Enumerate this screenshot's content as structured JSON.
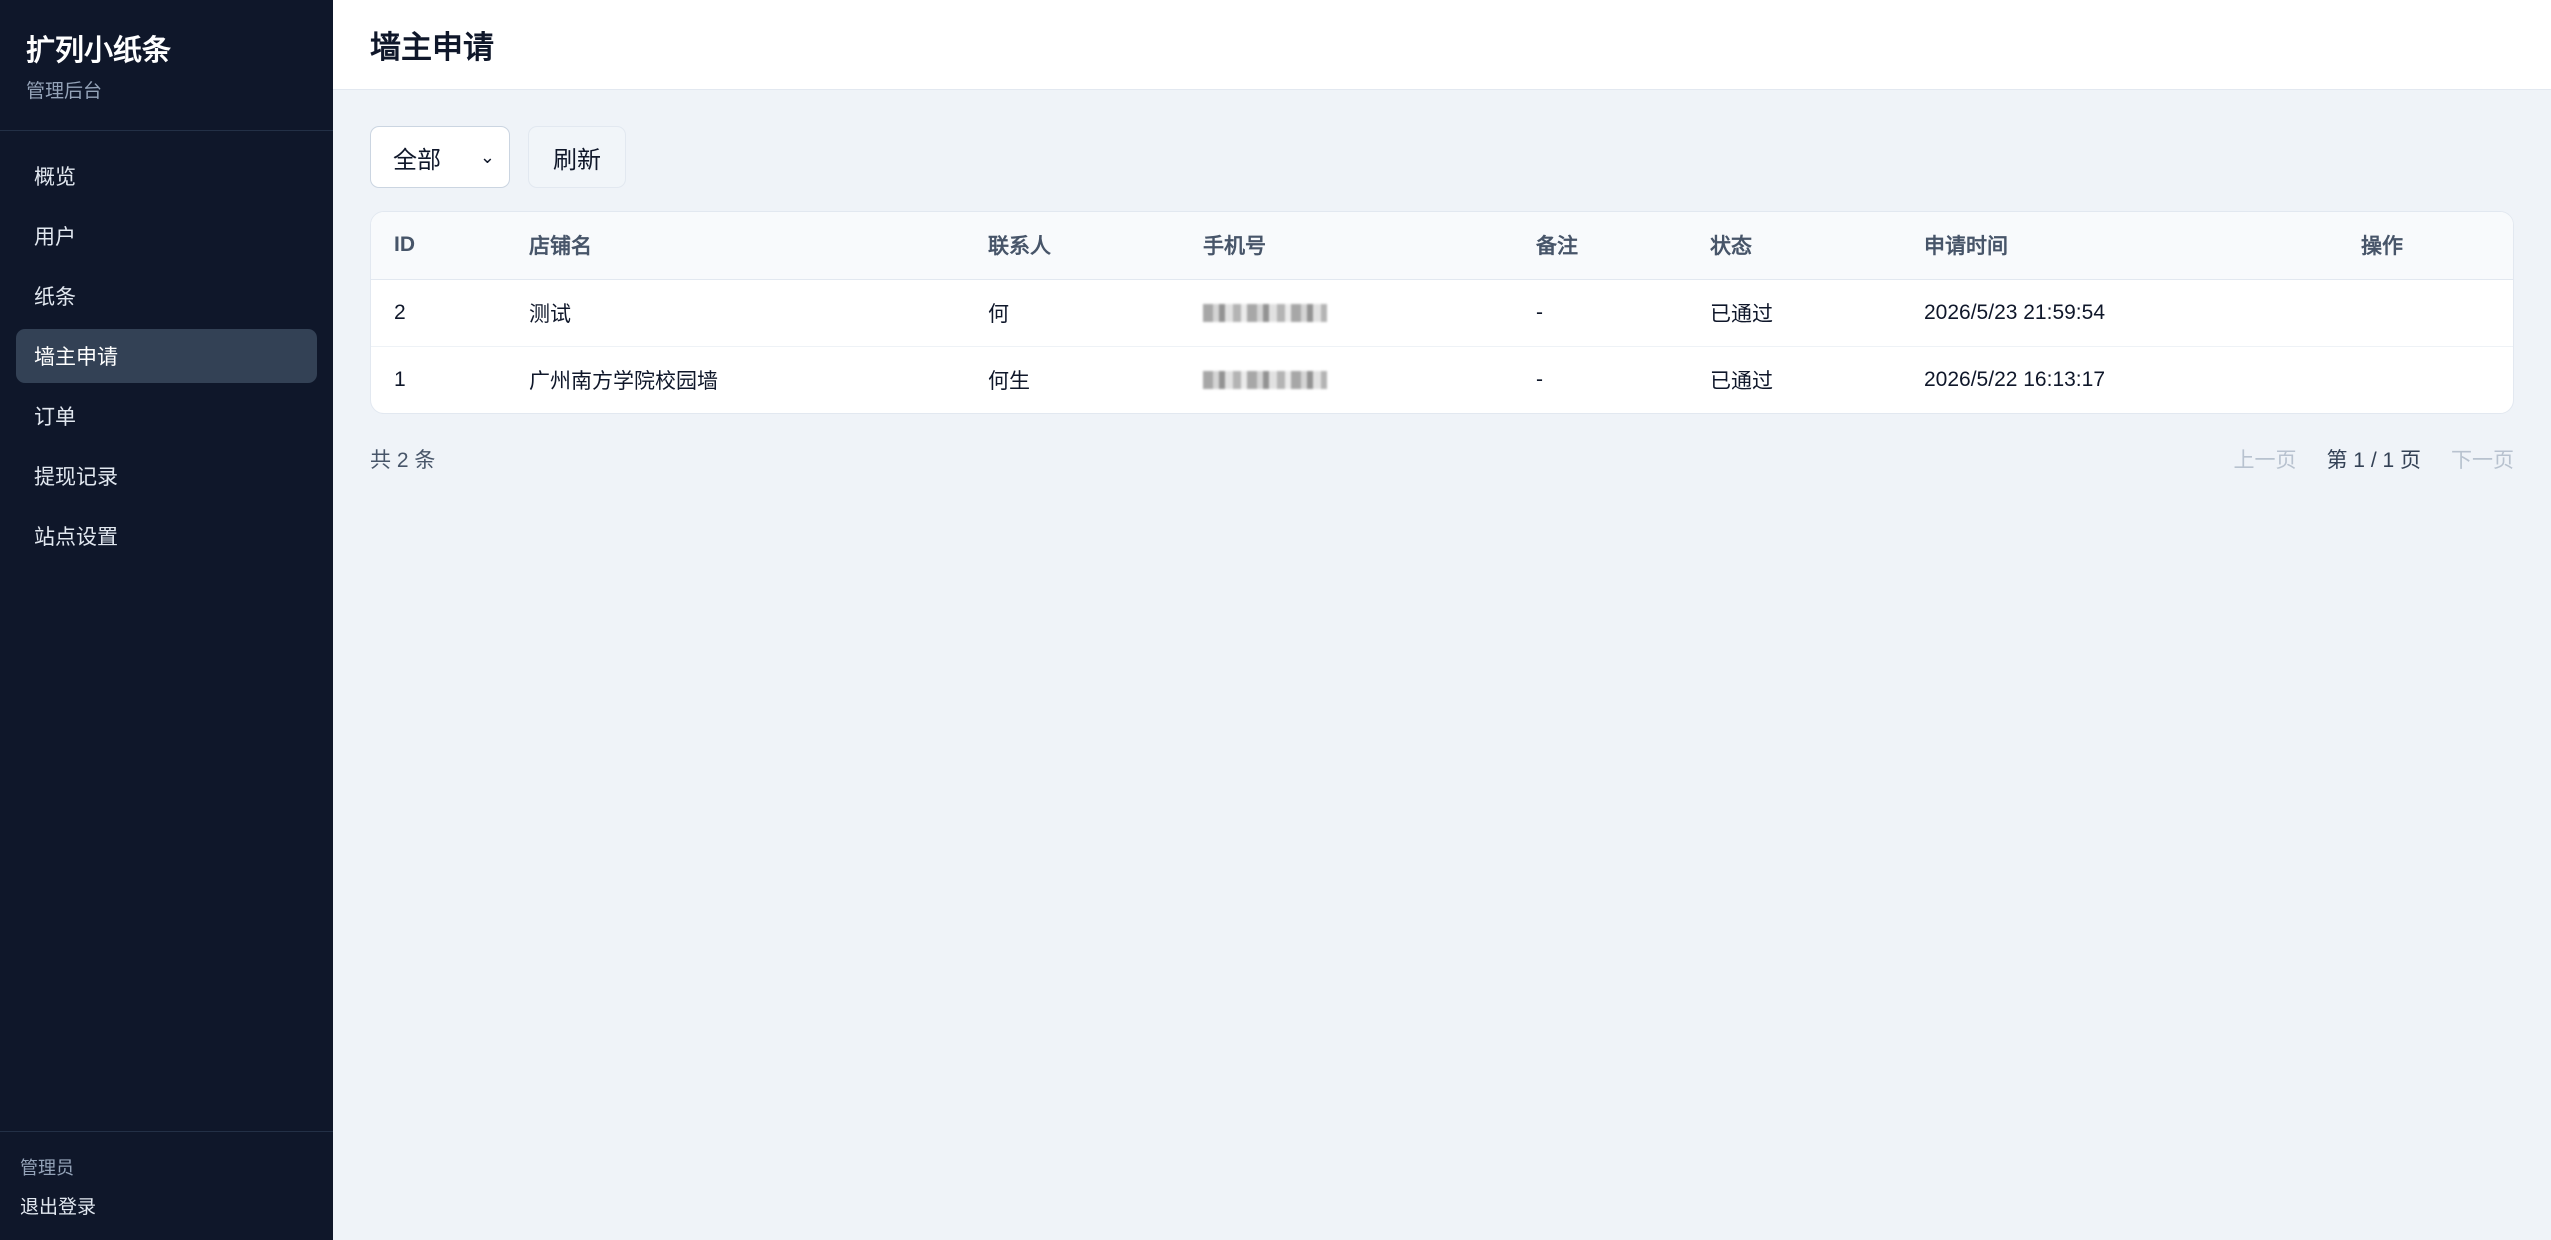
{
  "sidebar": {
    "brand_title": "扩列小纸条",
    "brand_subtitle": "管理后台",
    "items": [
      {
        "label": "概览"
      },
      {
        "label": "用户"
      },
      {
        "label": "纸条"
      },
      {
        "label": "墙主申请",
        "active": true
      },
      {
        "label": "订单"
      },
      {
        "label": "提现记录"
      },
      {
        "label": "站点设置"
      }
    ],
    "footer": {
      "role": "管理员",
      "logout": "退出登录"
    }
  },
  "header": {
    "title": "墙主申请"
  },
  "toolbar": {
    "filter_selected": "全部",
    "refresh_label": "刷新"
  },
  "table": {
    "columns": [
      "ID",
      "店铺名",
      "联系人",
      "手机号",
      "备注",
      "状态",
      "申请时间",
      "操作"
    ],
    "rows": [
      {
        "id": "2",
        "shop": "测试",
        "contact": "何",
        "phone": "",
        "remark": "-",
        "status": "已通过",
        "time": "2026/5/23 21:59:54",
        "action": ""
      },
      {
        "id": "1",
        "shop": "广州南方学院校园墙",
        "contact": "何生",
        "phone": "",
        "remark": "-",
        "status": "已通过",
        "time": "2026/5/22 16:13:17",
        "action": ""
      }
    ]
  },
  "pagination": {
    "total": "共 2 条",
    "prev": "上一页",
    "info": "第 1 / 1 页",
    "next": "下一页"
  },
  "colors": {
    "sidebar_bg": "#0f172a",
    "active_item_bg": "#334155",
    "page_bg": "#eff3f8"
  }
}
